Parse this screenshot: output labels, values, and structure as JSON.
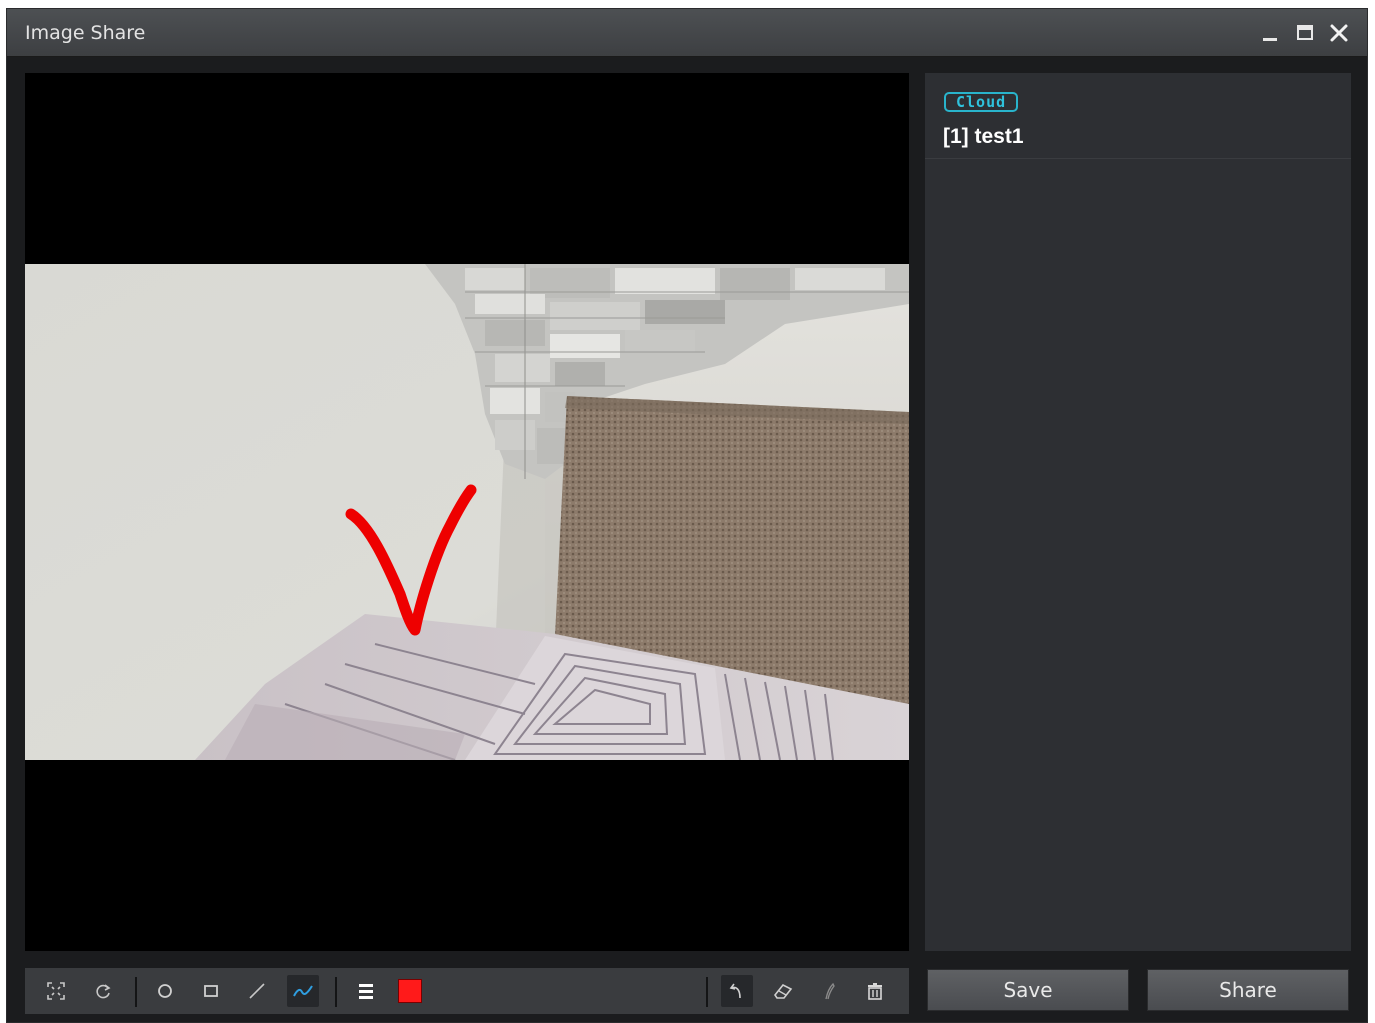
{
  "window": {
    "title": "Image Share",
    "controls": [
      "minimize-icon",
      "maximize-icon",
      "close-icon"
    ]
  },
  "viewer": {
    "annotation": {
      "shape": "check-mark",
      "color": "#ff0000"
    }
  },
  "side_list": {
    "items": [
      {
        "badge": "Cloud",
        "title": "[1] test1"
      }
    ]
  },
  "toolbar": {
    "tools": [
      "fit-screen-icon",
      "rotate-icon",
      "circle-icon",
      "rectangle-icon",
      "line-icon",
      "freehand-icon",
      "line-width-icon",
      "color-swatch",
      "undo-icon",
      "eraser-icon",
      "pen-icon",
      "trash-icon"
    ],
    "selected_tool": "freehand-icon",
    "pen_color": "#ff1a1a"
  },
  "actions": {
    "save_label": "Save",
    "share_label": "Share"
  }
}
